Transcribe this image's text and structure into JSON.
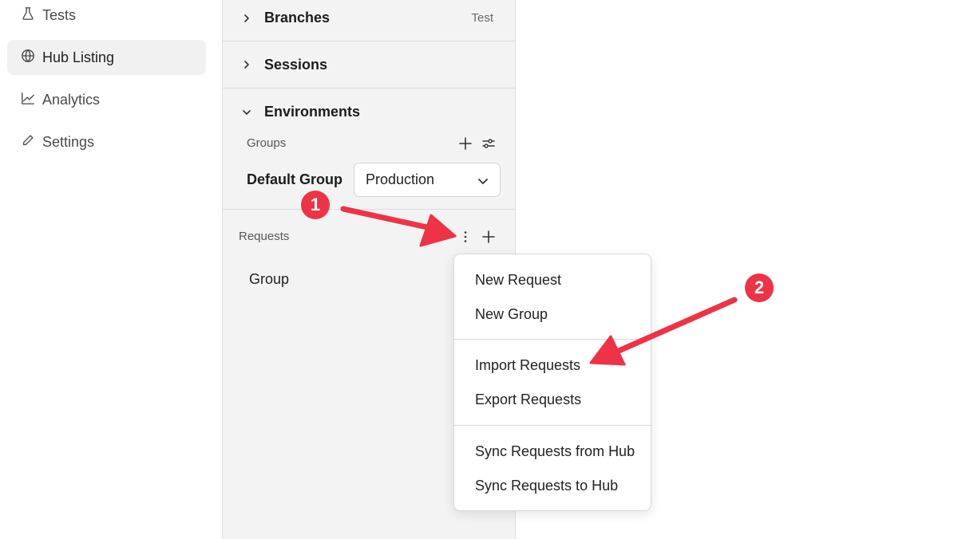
{
  "nav": {
    "items": [
      {
        "label": "Tests",
        "icon": "flask-icon"
      },
      {
        "label": "Hub Listing",
        "icon": "globe-icon",
        "active": true
      },
      {
        "label": "Analytics",
        "icon": "chart-line-icon"
      },
      {
        "label": "Settings",
        "icon": "pencil-icon"
      }
    ]
  },
  "panel": {
    "branches": {
      "title": "Branches",
      "aux": "Test"
    },
    "sessions": {
      "title": "Sessions"
    },
    "environments": {
      "title": "Environments",
      "groups_label": "Groups",
      "default_group_label": "Default Group",
      "selected_environment": "Production"
    },
    "requests": {
      "label": "Requests",
      "items": [
        "Group"
      ]
    }
  },
  "menu": {
    "items": [
      "New Request",
      "New Group",
      "Import Requests",
      "Export Requests",
      "Sync Requests from Hub",
      "Sync Requests to Hub"
    ]
  },
  "annotations": {
    "badge1": "1",
    "badge2": "2",
    "color": "#ee3346"
  }
}
